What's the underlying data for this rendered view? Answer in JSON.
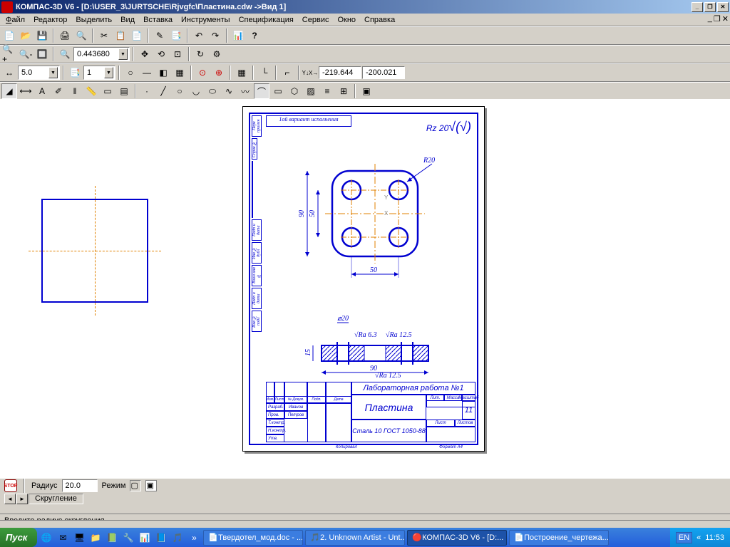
{
  "title": "КОМПАС-3D V6 - [D:\\USER_3\\JURTSCHE\\Rjvgfc\\Пластина.cdw ->Вид 1]",
  "menu": {
    "file": "Файл",
    "edit": "Редактор",
    "select": "Выделить",
    "view": "Вид",
    "insert": "Вставка",
    "tools": "Инструменты",
    "spec": "Спецификация",
    "service": "Сервис",
    "window": "Окно",
    "help": "Справка"
  },
  "zoom_value": "0.443680",
  "step_value": "5.0",
  "spin_value": "1",
  "coord_x": "-219.644",
  "coord_y": "-200.021",
  "coord_label": "Y↓X→",
  "drawing": {
    "surface_mark": "Rz 20",
    "radius_note": "R20",
    "dim_50_v1": "50",
    "dim_90_v": "90",
    "dim_50_h": "50",
    "dim_90_h": "90",
    "dim_15": "15",
    "dim_d20": "⌀20",
    "ra125": "Ra 12.5",
    "ra63": "Ra 6.3",
    "title_rot": "1ой вариант исполнения",
    "format": "Формат    A4",
    "copy": "Копировал"
  },
  "title_block": {
    "work": "Лабораторная работа №1",
    "name": "Пластина",
    "material": "Сталь 10 ГОСТ 1050-88",
    "sheet_count": "11",
    "разраб": "Разраб.",
    "пров": "Пров.",
    "тконтр": "Т.контр.",
    "нконтр": "Н.контр.",
    "утв": "Утв.",
    "name1": "Иванов",
    "name2": "Петров",
    "изм": "Изм.",
    "лист": "Лист",
    "ндокум": "№ Докум.",
    "подп": "Подп.",
    "дата": "Дата",
    "лит": "Лит.",
    "масса": "Масса",
    "масштаб": "Масштаб",
    "лист2": "Лист",
    "листов": "Листов"
  },
  "prop": {
    "radius_label": "Радиус",
    "radius_value": "20.0",
    "mode_label": "Режим",
    "tab": "Скругление"
  },
  "status": "Введите радиус скругления",
  "taskbar": {
    "start": "Пуск",
    "t1": "Твердотел_мод.doc - ...",
    "t2": "2. Unknown Artist - Unt...",
    "t3": "КОМПАС-3D V6 - [D:...",
    "t4": "Построение_чертежа....",
    "lang": "EN",
    "time": "11:53"
  }
}
